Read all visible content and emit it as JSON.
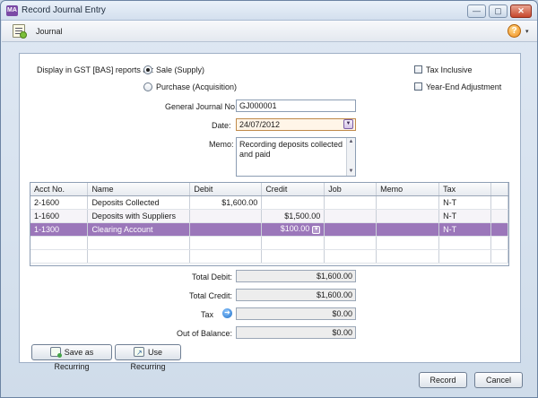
{
  "window": {
    "title": "Record Journal Entry",
    "app_icon_text": "MA"
  },
  "window_buttons": {
    "minimize": "—",
    "maximize": "▢",
    "close": "✕"
  },
  "toolbar": {
    "journal_label": "Journal",
    "help_symbol": "?",
    "help_arrow": "▾"
  },
  "form": {
    "gst_label": "Display in GST [BAS] reports as:",
    "sale_option": "Sale (Supply)",
    "purchase_option": "Purchase (Acquisition)",
    "selected_option": "Sale (Supply)",
    "tax_inclusive_label": "Tax Inclusive",
    "year_end_label": "Year-End Adjustment",
    "tax_inclusive_checked": false,
    "year_end_checked": false,
    "journal_no_label": "General Journal No.:",
    "journal_no_value": "GJ000001",
    "date_label": "Date:",
    "date_value": "24/07/2012",
    "memo_label": "Memo:",
    "memo_line1": "Recording deposits collected",
    "memo_line2": "and paid"
  },
  "grid": {
    "columns": [
      "Acct No.",
      "Name",
      "Debit",
      "Credit",
      "Job",
      "Memo",
      "Tax"
    ],
    "rows": [
      {
        "acct": "2-1600",
        "name": "Deposits Collected",
        "debit": "$1,600.00",
        "credit": "",
        "job": "",
        "memo": "",
        "tax": "N-T"
      },
      {
        "acct": "1-1600",
        "name": "Deposits with Suppliers",
        "debit": "",
        "credit": "$1,500.00",
        "job": "",
        "memo": "",
        "tax": "N-T"
      },
      {
        "acct": "1-1300",
        "name": "Clearing Account",
        "debit": "",
        "credit": "$100.00",
        "job": "",
        "memo": "",
        "tax": "N-T"
      }
    ],
    "selected_row": 2
  },
  "totals": {
    "total_debit_label": "Total Debit:",
    "total_debit": "$1,600.00",
    "total_credit_label": "Total Credit:",
    "total_credit": "$1,600.00",
    "tax_label": "Tax",
    "tax": "$0.00",
    "out_of_balance_label": "Out of Balance:",
    "out_of_balance": "$0.00"
  },
  "buttons": {
    "save_recurring": "Save as Recurring",
    "use_recurring": "Use Recurring",
    "record": "Record",
    "cancel": "Cancel"
  },
  "colors": {
    "selected_row": "#9b77ba",
    "accent": "#7b4aa6"
  }
}
